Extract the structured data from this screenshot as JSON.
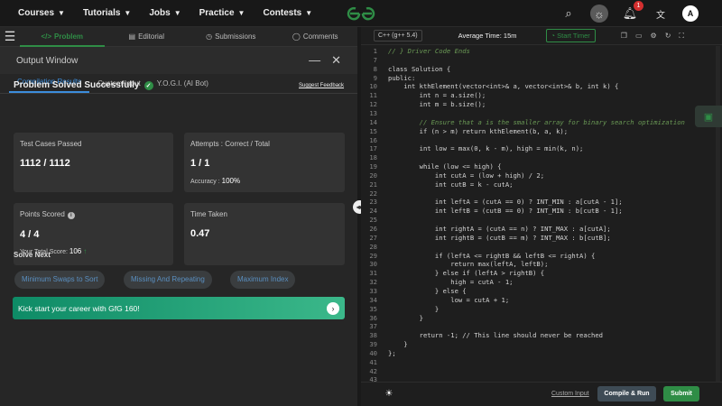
{
  "nav": {
    "items": [
      "Courses",
      "Tutorials",
      "Jobs",
      "Practice",
      "Contests"
    ],
    "notification_count": "1",
    "avatar_letter": "A"
  },
  "problem_tabs": [
    "Problem",
    "Editorial",
    "Submissions",
    "Comments"
  ],
  "output": {
    "title": "Output Window",
    "subtabs": [
      "Compilation Results",
      "Custom Input",
      "Y.O.G.I. (AI Bot)"
    ],
    "status": "Problem Solved Successfully",
    "suggest": "Suggest Feedback",
    "cards": {
      "tests_label": "Test Cases Passed",
      "tests_value": "1112 / 1112",
      "attempts_label": "Attempts : Correct / Total",
      "attempts_value": "1 / 1",
      "accuracy_label": "Accuracy :",
      "accuracy_value": "100%",
      "points_label": "Points Scored",
      "points_value": "4 / 4",
      "total_label": "Your Total Score:",
      "total_value": "106",
      "time_label": "Time Taken",
      "time_value": "0.47"
    },
    "solve_next": "Solve Next",
    "next_problems": [
      "Minimum Swaps to Sort",
      "Missing And Repeating",
      "Maximum Index"
    ],
    "banner": "Kick start your career with GfG 160!"
  },
  "editor": {
    "language": "C++ (g++ 5.4)",
    "avg_time": "Average Time: 15m",
    "timer": "Start Timer",
    "custom_input": "Custom Input",
    "compile_run": "Compile & Run",
    "submit": "Submit"
  },
  "code_lines": [
    {
      "n": "1",
      "t": "// } Driver Code Ends"
    },
    {
      "n": "7",
      "t": ""
    },
    {
      "n": "8",
      "t": "class Solution {"
    },
    {
      "n": "9",
      "t": "public:"
    },
    {
      "n": "10",
      "t": "    int kthElement(vector<int>& a, vector<int>& b, int k) {"
    },
    {
      "n": "11",
      "t": "        int n = a.size();"
    },
    {
      "n": "12",
      "t": "        int m = b.size();"
    },
    {
      "n": "13",
      "t": ""
    },
    {
      "n": "14",
      "t": "        // Ensure that a is the smaller array for binary search optimization"
    },
    {
      "n": "15",
      "t": "        if (n > m) return kthElement(b, a, k);"
    },
    {
      "n": "16",
      "t": ""
    },
    {
      "n": "17",
      "t": "        int low = max(0, k - m), high = min(k, n);"
    },
    {
      "n": "18",
      "t": ""
    },
    {
      "n": "19",
      "t": "        while (low <= high) {"
    },
    {
      "n": "20",
      "t": "            int cutA = (low + high) / 2;"
    },
    {
      "n": "21",
      "t": "            int cutB = k - cutA;"
    },
    {
      "n": "22",
      "t": ""
    },
    {
      "n": "23",
      "t": "            int leftA = (cutA == 0) ? INT_MIN : a[cutA - 1];"
    },
    {
      "n": "24",
      "t": "            int leftB = (cutB == 0) ? INT_MIN : b[cutB - 1];"
    },
    {
      "n": "25",
      "t": ""
    },
    {
      "n": "26",
      "t": "            int rightA = (cutA == n) ? INT_MAX : a[cutA];"
    },
    {
      "n": "27",
      "t": "            int rightB = (cutB == m) ? INT_MAX : b[cutB];"
    },
    {
      "n": "28",
      "t": ""
    },
    {
      "n": "29",
      "t": "            if (leftA <= rightB && leftB <= rightA) {"
    },
    {
      "n": "30",
      "t": "                return max(leftA, leftB);"
    },
    {
      "n": "31",
      "t": "            } else if (leftA > rightB) {"
    },
    {
      "n": "32",
      "t": "                high = cutA - 1;"
    },
    {
      "n": "33",
      "t": "            } else {"
    },
    {
      "n": "34",
      "t": "                low = cutA + 1;"
    },
    {
      "n": "35",
      "t": "            }"
    },
    {
      "n": "36",
      "t": "        }"
    },
    {
      "n": "37",
      "t": ""
    },
    {
      "n": "38",
      "t": "        return -1; // This line should never be reached"
    },
    {
      "n": "39",
      "t": "    }"
    },
    {
      "n": "40",
      "t": "};"
    },
    {
      "n": "41",
      "t": ""
    },
    {
      "n": "42",
      "t": ""
    },
    {
      "n": "43",
      "t": ""
    }
  ]
}
